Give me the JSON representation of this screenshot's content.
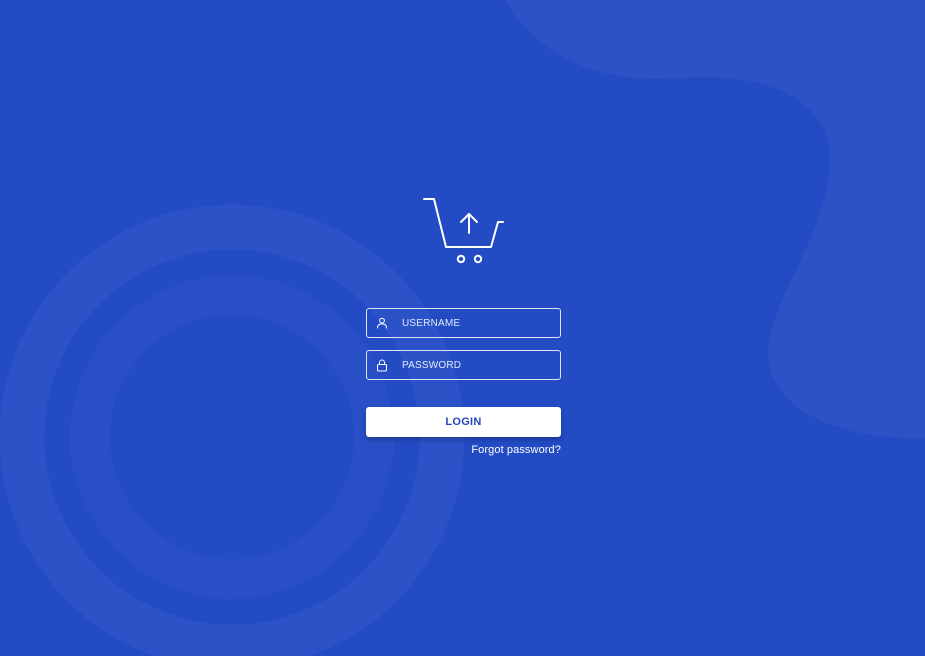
{
  "logo": {
    "icon": "shopping-cart-upload-icon"
  },
  "form": {
    "username": {
      "placeholder": "USERNAME",
      "value": "",
      "icon": "user-icon"
    },
    "password": {
      "placeholder": "PASSWORD",
      "value": "",
      "icon": "lock-icon"
    },
    "login_label": "LOGIN",
    "forgot_label": "Forgot password?"
  },
  "colors": {
    "background": "#234bc4",
    "button_background": "#ffffff",
    "button_text": "#2446b8",
    "text": "#ffffff"
  }
}
